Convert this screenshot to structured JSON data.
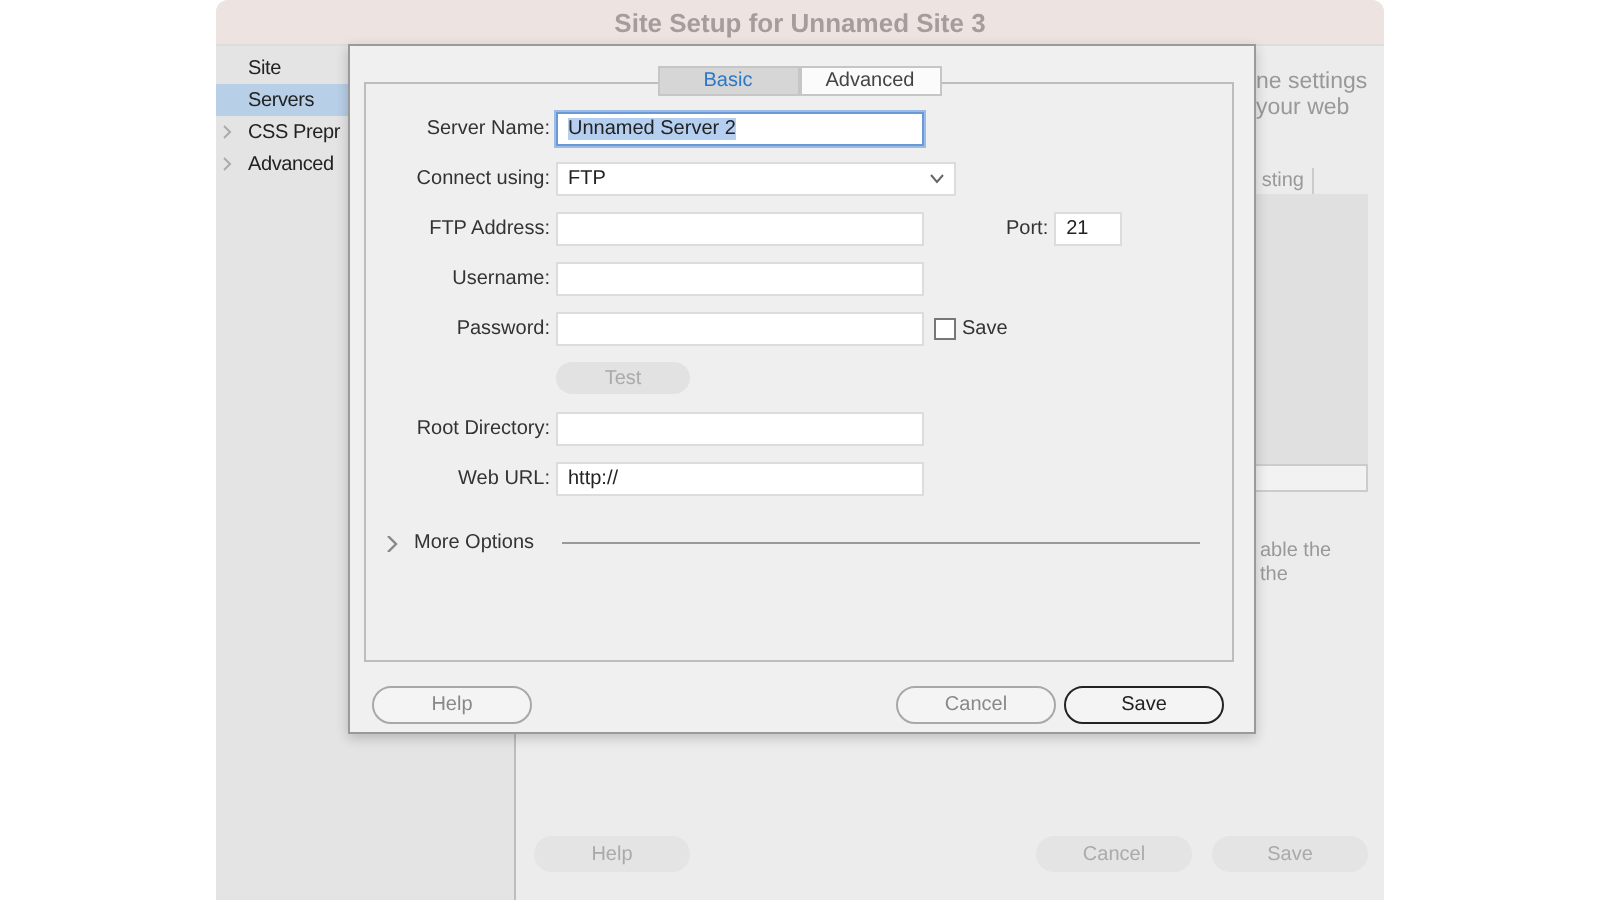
{
  "window": {
    "title": "Site Setup for Unnamed Site 3"
  },
  "sidebar": {
    "items": [
      {
        "label": "Site",
        "selected": false,
        "expandable": false
      },
      {
        "label": "Servers",
        "selected": true,
        "expandable": false
      },
      {
        "label": "CSS Prepr",
        "selected": false,
        "expandable": true
      },
      {
        "label": "Advanced",
        "selected": false,
        "expandable": true
      }
    ]
  },
  "background_panel": {
    "top_texts": [
      "ne settings",
      "your web"
    ],
    "tab_fragment": "sting",
    "bottom_texts": [
      "able the",
      "the"
    ],
    "buttons": [
      {
        "label": "Help",
        "disabled": true
      },
      {
        "label": "Cancel",
        "disabled": true
      },
      {
        "label": "Save",
        "disabled": true
      }
    ]
  },
  "dialog": {
    "tabs": [
      {
        "label": "Basic",
        "selected": true
      },
      {
        "label": "Advanced",
        "selected": false
      }
    ],
    "fields": [
      {
        "kind": "text",
        "label": "Server Name:",
        "value": "Unnamed Server 2",
        "focused": true
      },
      {
        "kind": "select",
        "label": "Connect using:",
        "value": "FTP"
      },
      {
        "kind": "text",
        "label": "FTP Address:",
        "port": {
          "label": "Port:",
          "value": "21"
        }
      },
      {
        "kind": "text",
        "label": "Username:"
      },
      {
        "kind": "text",
        "label": "Password:",
        "checkbox": {
          "label": "Save",
          "checked": false
        }
      },
      {
        "kind": "button",
        "label": "Test",
        "disabled": true
      },
      {
        "kind": "text",
        "label": "Root Directory:"
      },
      {
        "kind": "text",
        "label": "Web URL:",
        "value": "http://"
      }
    ],
    "more_options": {
      "label": "More Options",
      "expanded": false
    },
    "buttons": [
      {
        "label": "Help",
        "default": false
      },
      {
        "label": "Cancel",
        "default": false
      },
      {
        "label": "Save",
        "default": true
      }
    ]
  }
}
